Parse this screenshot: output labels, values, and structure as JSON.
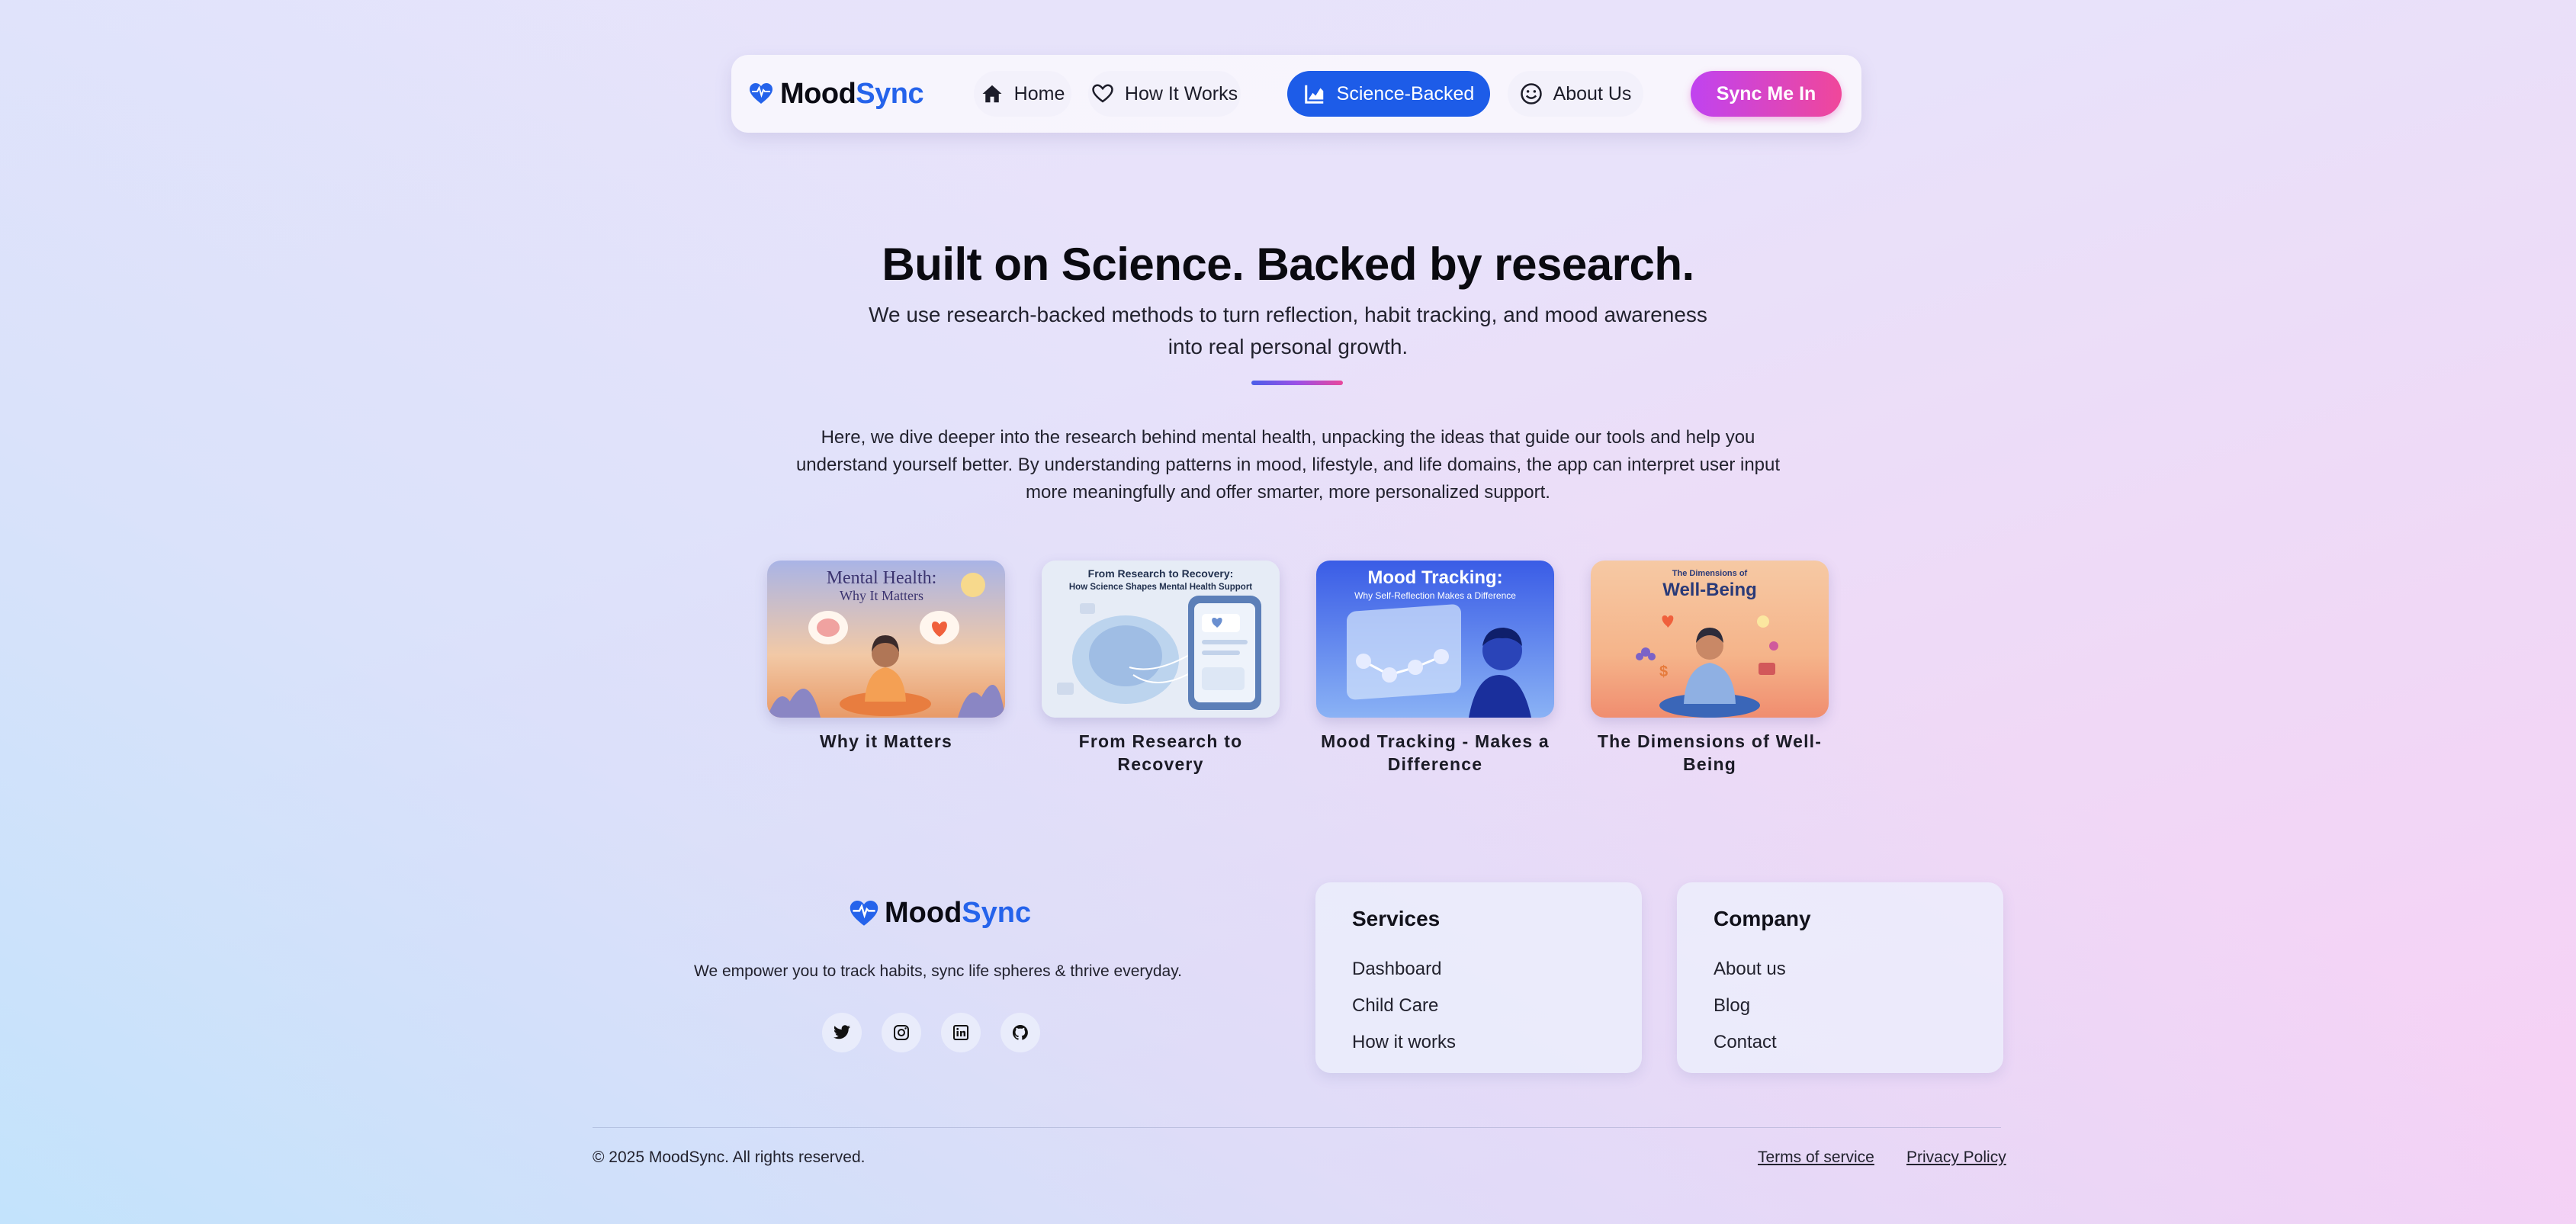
{
  "brand": {
    "part1": "Mood",
    "part2": "Sync",
    "accent": "#2563eb"
  },
  "nav": {
    "items": [
      {
        "label": "Home",
        "icon": "home-icon"
      },
      {
        "label": "How It Works",
        "icon": "heart-icon"
      },
      {
        "label": "Science-Backed",
        "icon": "chart-icon",
        "active": true
      },
      {
        "label": "About Us",
        "icon": "smile-icon"
      }
    ],
    "cta": "Sync Me In"
  },
  "hero": {
    "title": "Built on Science. Backed by research.",
    "subtitle": "We use research-backed methods to turn reflection, habit tracking, and mood awareness into real personal growth.",
    "intro": "Here, we dive deeper into the research behind mental health, unpacking the ideas that guide our tools and help you understand yourself better. By understanding patterns in mood, lifestyle, and life domains, the app can interpret user input more meaningfully and offer smarter, more personalized support."
  },
  "cards": [
    {
      "caption": "Why it Matters",
      "img_title": "Mental Health:",
      "img_sub": "Why It Matters"
    },
    {
      "caption": "From Research to Recovery",
      "img_title": "From Research to Recovery:",
      "img_sub": "How Science Shapes Mental Health Support"
    },
    {
      "caption": "Mood Tracking - Makes a Difference",
      "img_title": "Mood Tracking:",
      "img_sub": "Why Self-Reflection Makes a Difference"
    },
    {
      "caption": "The Dimensions of Well-Being",
      "img_title": "Well-Being",
      "img_sub": "The Dimensions of"
    }
  ],
  "footer": {
    "tagline": "We empower you to track habits, sync life spheres & thrive everyday.",
    "socials": [
      "twitter-icon",
      "instagram-icon",
      "linkedin-icon",
      "github-icon"
    ],
    "services": {
      "title": "Services",
      "links": [
        "Dashboard",
        "Child Care",
        "How it works"
      ]
    },
    "company": {
      "title": "Company",
      "links": [
        "About us",
        "Blog",
        "Contact"
      ]
    },
    "copyright": "© 2025 MoodSync. All rights reserved.",
    "terms": "Terms of service",
    "privacy": "Privacy Policy"
  }
}
